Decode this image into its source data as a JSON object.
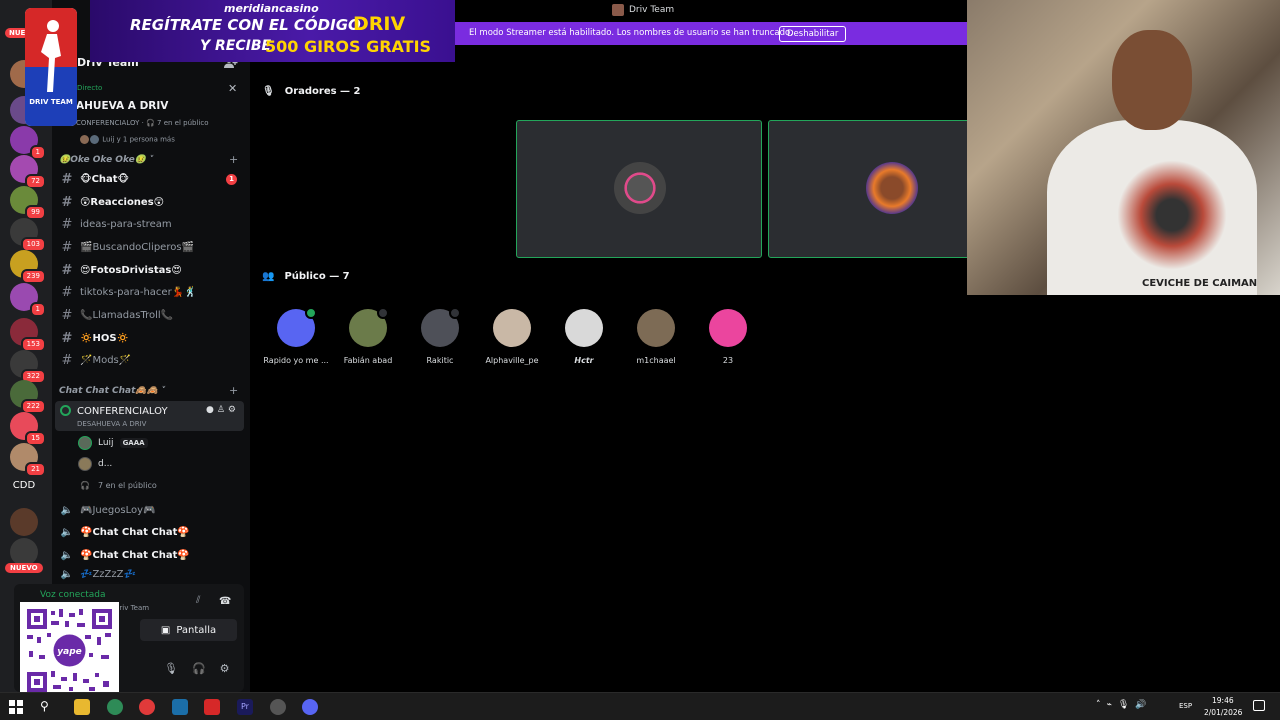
{
  "window": {
    "title": "Driv Team",
    "streamer_notice": "El modo Streamer está habilitado. Los nombres de usuario se han truncado.",
    "disable_label": "Deshabilitar"
  },
  "banner": {
    "brand": "meridiancasino",
    "line1": "REGÍTRATE CON EL CÓDIGO",
    "code": "DRIV",
    "line2": "Y RECIBE",
    "promo": "500 GIROS GRATIS",
    "logo_text": "DRIV TEAM"
  },
  "server_rail": {
    "top_badge": "NUE",
    "badges": [
      "1",
      "72",
      "99",
      "103",
      "239",
      "1",
      "153",
      "322",
      "222",
      "15",
      "21"
    ],
    "cdd_label": "CDD",
    "nuevo_label": "NUEVO"
  },
  "sidebar": {
    "server_name": "Driv Team ˅",
    "live": {
      "label": "Directo",
      "title": "AHUEVA A DRIV",
      "subtitle": "CONFERENCIALOY · 🎧 7 en el público",
      "people": "Luij y 1 persona más"
    },
    "category1": "🤢Oke Oke Oke🤢 ˅",
    "channels": [
      {
        "name": "🐵Chat🐵",
        "badge": "1"
      },
      {
        "name": "😲Reacciones😲"
      },
      {
        "name": "ideas-para-stream"
      },
      {
        "name": "🎬BuscandoCliperos🎬"
      },
      {
        "name": "😍FotosDrivistas😍"
      },
      {
        "name": "tiktoks-para-hacer💃🕺"
      },
      {
        "name": "📞LlamadasTroll📞"
      },
      {
        "name": "🔅HOS🔅"
      },
      {
        "name": "🪄Mods🪄"
      }
    ],
    "category2": "Chat Chat Chat🙈🙈 ˅",
    "voice_channel": {
      "name": "CONFERENCIALOY",
      "subtitle": "DESAHUEVA A DRIV"
    },
    "voice_users": [
      {
        "name": "Luij",
        "tag": "GAAA"
      },
      {
        "name": "d..."
      }
    ],
    "audience_count": "7 en el público",
    "more_voice_channels": [
      {
        "name": "🎮JuegosLoy🎮"
      },
      {
        "name": "🍄Chat Chat Chat🍄"
      },
      {
        "name": "🍄Chat Chat Chat🍄"
      },
      {
        "name": "💤ZzZzZ💤"
      }
    ]
  },
  "voice_panel": {
    "status": "Voz conectada",
    "server": "Driv Team",
    "screen_label": "Pantalla"
  },
  "stage": {
    "speakers_header": "Oradores — 2",
    "public_header": "Público — 7",
    "audience": [
      {
        "name": "Rapido yo me ...",
        "color": "#5865f2"
      },
      {
        "name": "Fabián abad",
        "color": "#6b7b4a"
      },
      {
        "name": "Rakitic",
        "color": "#4e5058"
      },
      {
        "name": "Alphaville_pe",
        "color": "#c9b8a6"
      },
      {
        "name": "𝙃𝙘𝙩𝙧",
        "color": "#d9d9d9"
      },
      {
        "name": "m1chaael",
        "color": "#7d6b55"
      },
      {
        "name": "23",
        "color": "#eb459e"
      }
    ]
  },
  "webcam": {
    "caption": "CEVICHE DE CAIMAN"
  },
  "taskbar": {
    "lang": "ESP",
    "time": "19:46",
    "date": "2/01/2026"
  },
  "colors": {
    "accent": "#5865f2",
    "green": "#23a55a",
    "red": "#f23f43",
    "streamer": "#7a2ce0"
  }
}
